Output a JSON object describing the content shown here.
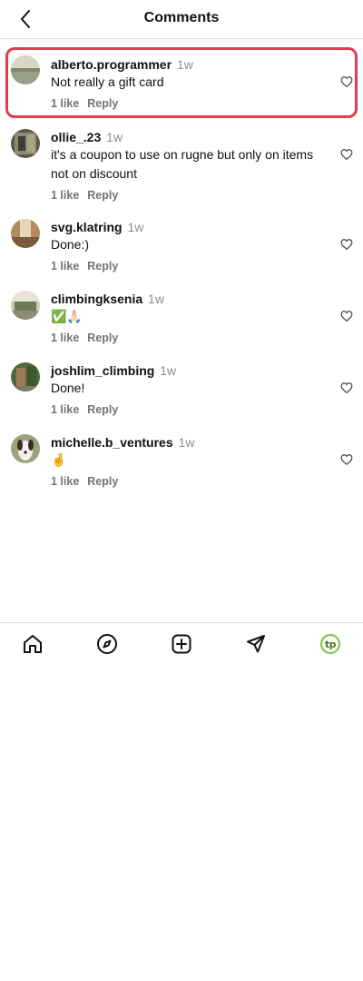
{
  "header": {
    "title": "Comments"
  },
  "comments": [
    {
      "username": "alberto.programmer",
      "time": "1w",
      "text": "Not really a gift card",
      "likes": "1 like",
      "reply": "Reply"
    },
    {
      "username": "ollie_.23",
      "time": "1w",
      "text": "it's a coupon to use on rugne but only on items not on discount",
      "likes": "1 like",
      "reply": "Reply"
    },
    {
      "username": "svg.klatring",
      "time": "1w",
      "text": "Done:)",
      "likes": "1 like",
      "reply": "Reply"
    },
    {
      "username": "climbingksenia",
      "time": "1w",
      "text": "✅🙏🏻",
      "likes": "1 like",
      "reply": "Reply"
    },
    {
      "username": "joshlim_climbing",
      "time": "1w",
      "text": "Done!",
      "likes": "1 like",
      "reply": "Reply"
    },
    {
      "username": "michelle.b_ventures",
      "time": "1w",
      "text": "🤞",
      "likes": "1 like",
      "reply": "Reply"
    }
  ],
  "bottom_nav": {
    "profile_badge": "tp"
  }
}
